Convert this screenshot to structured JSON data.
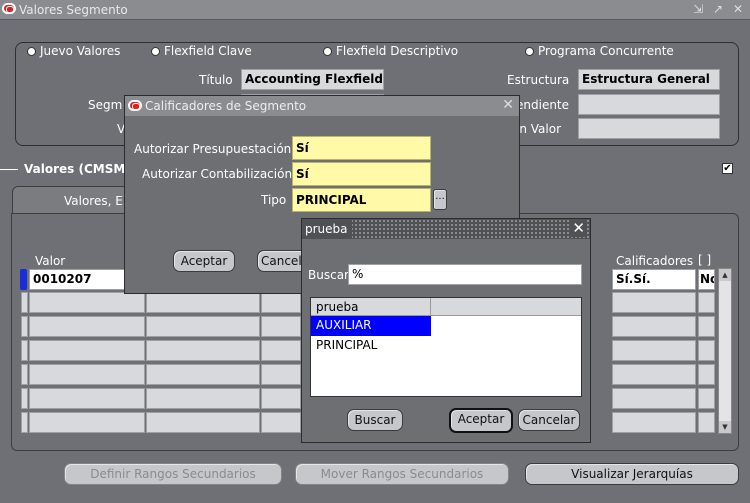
{
  "window": {
    "title": "Valores Segmento",
    "controls": [
      "⇲",
      "↗",
      "✕"
    ]
  },
  "view_options": [
    {
      "label": "Juevo Valores",
      "underline": "J"
    },
    {
      "label": "Flexfield Clave",
      "underline": "x"
    },
    {
      "label": "Flexfield Descriptivo",
      "underline": "l"
    },
    {
      "label": "Programa Concurrente",
      "underline": "C"
    }
  ],
  "header_fields": {
    "titulo_label": "Título",
    "titulo_value": "Accounting Flexfield",
    "estructura_label": "Estructura",
    "estructura_value": "Estructura General",
    "segmento_label": "Segm",
    "dependiente_label": "endiente",
    "valor_label": "V",
    "conjunto_valor_label": "ón Valor"
  },
  "values_section": {
    "title": "Valores (CMSM_",
    "tab_label": "Valores, E",
    "valor_col": "Valor",
    "calificadores_col": "Calificadores",
    "brackets": "[ ]",
    "first_value": "0010207",
    "first_calificadores": "Sí.Sí.",
    "first_last": "No"
  },
  "bottom_buttons": {
    "definir": "Definir Rangos Secundarios",
    "mover": "Mover Rangos Secundarios",
    "visualizar": "Visualizar Jerarquías"
  },
  "calificadores_dialog": {
    "title": "Calificadores de Segmento",
    "presupuestacion_label": "Autorizar Presupuestación",
    "presupuestacion_value": "Sí",
    "contabilizacion_label": "Autorizar Contabilización",
    "contabilizacion_value": "Sí",
    "tipo_label": "Tipo",
    "tipo_value": "PRINCIPAL",
    "lov_button": "...",
    "aceptar": "Aceptar",
    "cancelar": "Cancel"
  },
  "prueba_dialog": {
    "title": "prueba",
    "buscar_label": "Buscar",
    "buscar_value": "%",
    "column_header": "prueba",
    "items": [
      "AUXILIAR",
      "PRINCIPAL"
    ],
    "selected_index": 0,
    "buscar_button": "Buscar",
    "aceptar_button": "Aceptar",
    "cancelar_button": "Cancelar"
  },
  "colors": {
    "background": "#6f7075",
    "selection": "#0000ff",
    "required_field": "#fff9a8",
    "record_indicator": "#1a2bd8"
  }
}
